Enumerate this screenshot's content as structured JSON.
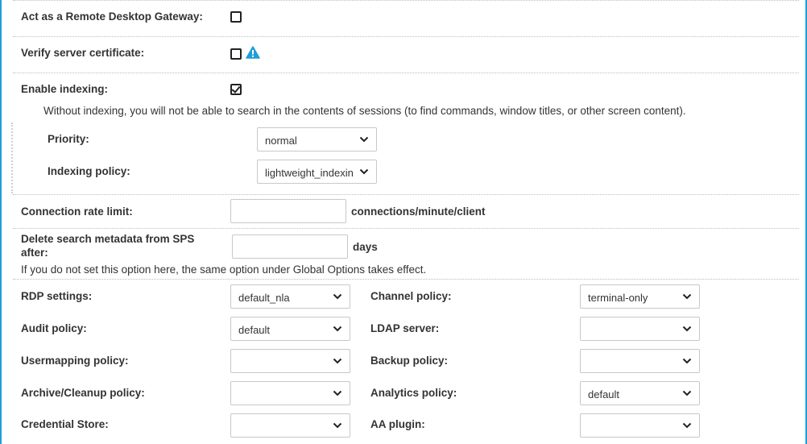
{
  "gateway": {
    "label": "Act as a Remote Desktop Gateway:",
    "checked": false
  },
  "verify_cert": {
    "label": "Verify server certificate:",
    "checked": false
  },
  "indexing": {
    "label": "Enable indexing:",
    "checked": true,
    "note": "Without indexing, you will not be able to search in the contents of sessions (to find commands, window titles, or other screen content).",
    "priority_label": "Priority:",
    "priority_value": "normal",
    "policy_label": "Indexing policy:",
    "policy_value": "lightweight_indexing"
  },
  "rate_limit": {
    "label": "Connection rate limit:",
    "value": "",
    "unit": "connections/minute/client"
  },
  "delete_metadata": {
    "label_line1": "Delete search metadata from SPS",
    "label_line2": "after:",
    "value": "",
    "unit": "days",
    "note": "If you do not set this option here, the same option under Global Options takes effect."
  },
  "policies": {
    "rdp_label": "RDP settings:",
    "rdp_value": "default_nla",
    "channel_label": "Channel policy:",
    "channel_value": "terminal-only",
    "audit_label": "Audit policy:",
    "audit_value": "default",
    "ldap_label": "LDAP server:",
    "ldap_value": "",
    "usermapping_label": "Usermapping policy:",
    "usermapping_value": "",
    "backup_label": "Backup policy:",
    "backup_value": "",
    "archive_label": "Archive/Cleanup policy:",
    "archive_value": "",
    "analytics_label": "Analytics policy:",
    "analytics_value": "default",
    "credential_label": "Credential Store:",
    "credential_value": "",
    "aa_label": "AA plugin:",
    "aa_value": ""
  },
  "colors": {
    "accent": "#1e9fd8",
    "warning": "#1e9fd8"
  },
  "icons": {
    "warning": "warning-triangle-icon",
    "dropdown": "chevron-down-icon",
    "check": "checkmark-icon"
  }
}
